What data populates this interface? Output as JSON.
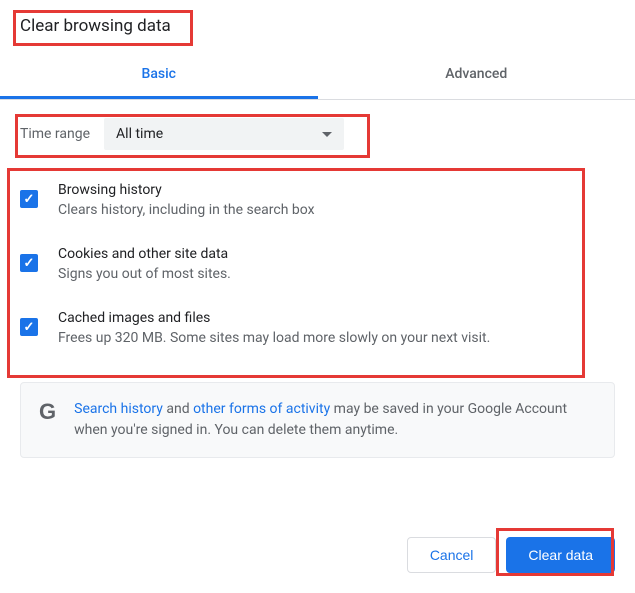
{
  "dialog": {
    "title": "Clear browsing data"
  },
  "tabs": {
    "basic": "Basic",
    "advanced": "Advanced"
  },
  "timeRange": {
    "label": "Time range",
    "value": "All time"
  },
  "options": [
    {
      "title": "Browsing history",
      "desc": "Clears history, including in the search box"
    },
    {
      "title": "Cookies and other site data",
      "desc": "Signs you out of most sites."
    },
    {
      "title": "Cached images and files",
      "desc": "Frees up 320 MB. Some sites may load more slowly on your next visit."
    }
  ],
  "info": {
    "link1": "Search history",
    "mid1": " and ",
    "link2": "other forms of activity",
    "rest": " may be saved in your Google Account when you're signed in. You can delete them anytime."
  },
  "buttons": {
    "cancel": "Cancel",
    "clear": "Clear data"
  }
}
